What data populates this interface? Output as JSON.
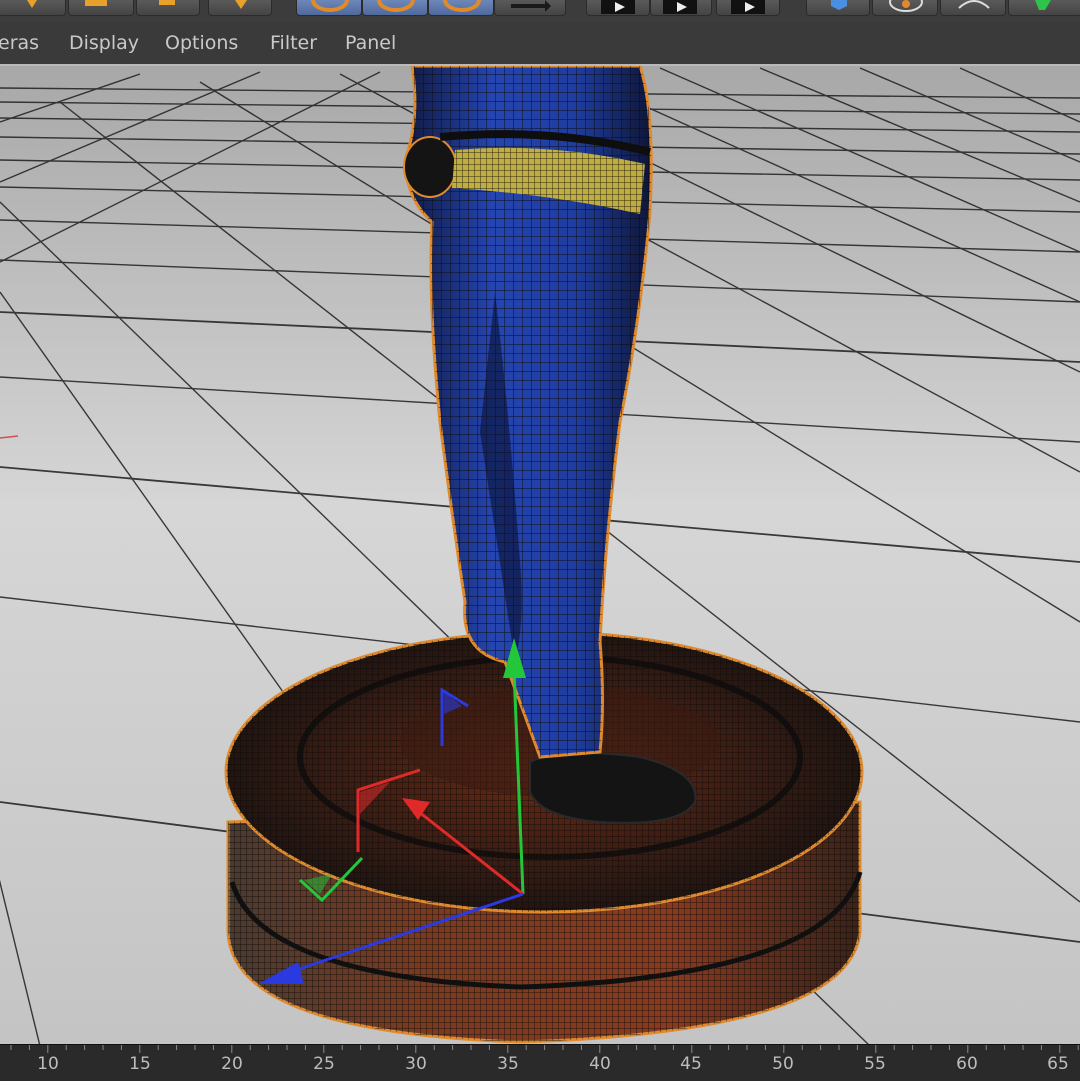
{
  "menu": {
    "items": [
      {
        "label": "eras"
      },
      {
        "label": "Display"
      },
      {
        "label": "Options"
      },
      {
        "label": "Filter"
      },
      {
        "label": "Panel"
      }
    ]
  },
  "toolbar": {
    "icons": [
      "move-icon",
      "grid-icon",
      "render-icon",
      "pin-icon",
      "circle-icon-1",
      "circle-icon-2",
      "circle-icon-3",
      "arrow-icon",
      "play-icon-1",
      "play-icon-2",
      "play-icon-3",
      "cube-icon",
      "sphere-icon",
      "rotate-icon",
      "gem-icon"
    ]
  },
  "viewport": {
    "floor_color": "#d4d4d4",
    "grid_color": "#222222",
    "model_color": "#1f3c9e",
    "belt_color": "#c9b43c",
    "selection_outline_color": "#e08a2c",
    "axis_colors": {
      "x": "#e02a2a",
      "y": "#22c83a",
      "z": "#2a3ae0"
    }
  },
  "timeline": {
    "ticks": [
      "10",
      "15",
      "20",
      "25",
      "30",
      "35",
      "40",
      "45",
      "50",
      "55",
      "60",
      "65"
    ]
  }
}
